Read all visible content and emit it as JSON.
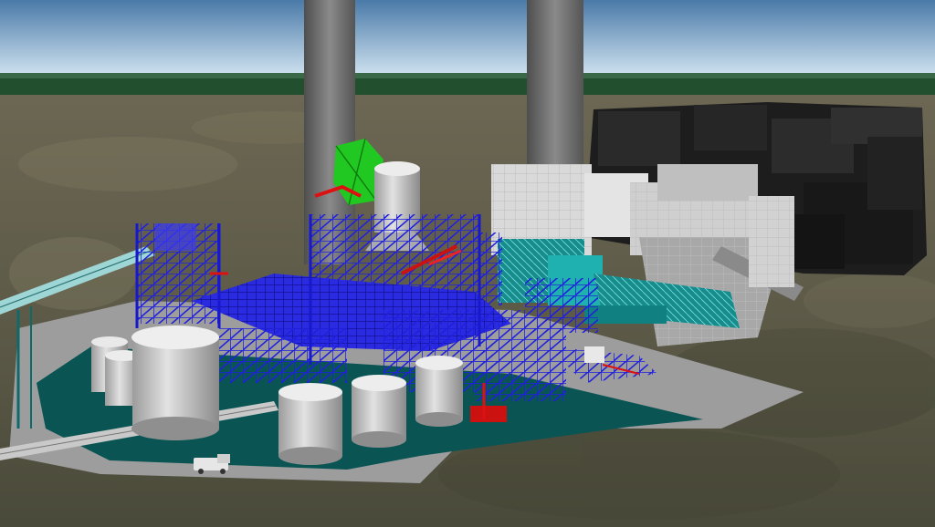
{
  "scene": {
    "colors": {
      "sky_top": "#3e6a96",
      "sky_bottom": "#cfe2f0",
      "forest": "#1f4a2a",
      "ground": "#6f6a55",
      "ground_dark": "#4d4a3a",
      "pad": "#9a9a9a",
      "pad_teal": "#0a4e4e",
      "steel_blue": "#1a1acc",
      "steel_blue_light": "#4444ff",
      "tank": "#c8c8c8",
      "tank_shade": "#8c8c8c",
      "stack": "#6e6e6e",
      "boiler_gray": "#d6d6d6",
      "black_building": "#1c1c1c",
      "accent_red": "#cc1111",
      "accent_green": "#22cc22",
      "accent_teal": "#14a6a6"
    }
  }
}
